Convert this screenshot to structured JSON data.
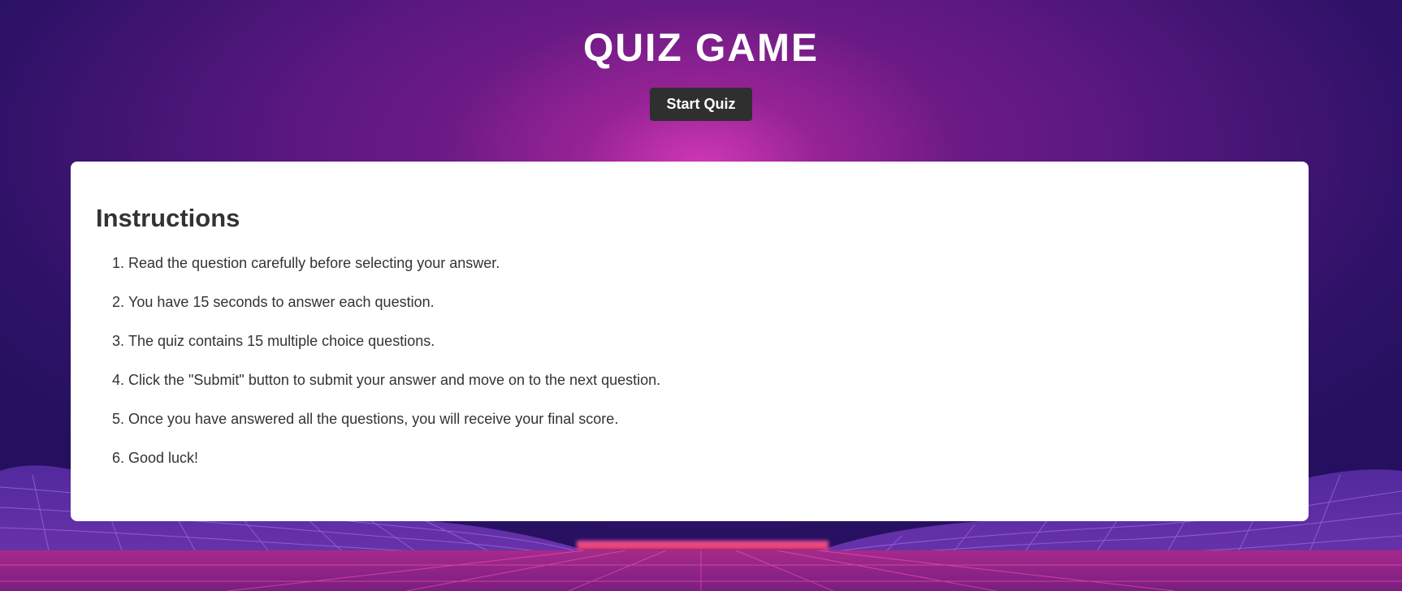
{
  "header": {
    "title": "QUIZ GAME",
    "start_button_label": "Start Quiz"
  },
  "instructions": {
    "heading": "Instructions",
    "items": [
      "Read the question carefully before selecting your answer.",
      "You have 15 seconds to answer each question.",
      "The quiz contains 15 multiple choice questions.",
      "Click the \"Submit\" button to submit your answer and move on to the next question.",
      "Once you have answered all the questions, you will receive your final score.",
      "Good luck!"
    ]
  },
  "colors": {
    "button_bg": "#2f2f2f",
    "card_bg": "#ffffff",
    "text": "#333333",
    "title": "#ffffff"
  }
}
